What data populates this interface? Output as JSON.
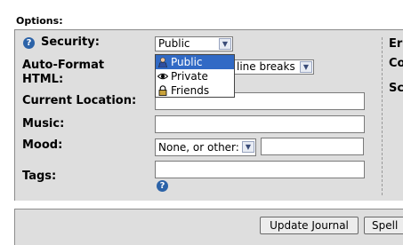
{
  "options": {
    "heading": "Options:"
  },
  "fields": {
    "security_label": "Security:",
    "security_value": "Public",
    "autoformat_label_line1": "Auto-Format",
    "autoformat_label_line2": "HTML:",
    "autoformat_value": "line breaks",
    "location_label": "Current Location:",
    "location_value": "",
    "music_label": "Music:",
    "music_value": "",
    "mood_label": "Mood:",
    "mood_value": "None, or other:",
    "mood_other_value": "",
    "tags_label": "Tags:",
    "tags_value": ""
  },
  "security_dropdown": {
    "options": [
      {
        "label": "Public",
        "icon": "person-icon",
        "selected": true
      },
      {
        "label": "Private",
        "icon": "eye-icon",
        "selected": false
      },
      {
        "label": "Friends",
        "icon": "lock-icon",
        "selected": false
      }
    ]
  },
  "right_column_clipped": [
    "Er",
    "Co",
    "Sc"
  ],
  "buttons": {
    "update": "Update Journal",
    "spell": "Spell"
  },
  "colors": {
    "panel_bg": "#dedede",
    "selection_bg": "#316ac5",
    "help_icon": "#2c63a8"
  }
}
